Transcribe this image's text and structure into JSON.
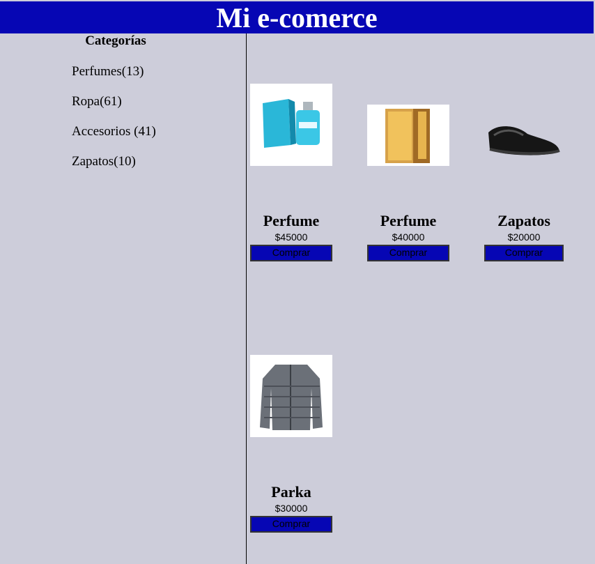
{
  "header": {
    "title": "Mi e-comerce"
  },
  "sidebar": {
    "title": "Categorías",
    "items": [
      {
        "label": "Perfumes(13)"
      },
      {
        "label": "Ropa(61)"
      },
      {
        "label": "Accesorios (41)"
      },
      {
        "label": "Zapatos(10)"
      }
    ]
  },
  "products": [
    {
      "name": "Perfume",
      "price": "$45000",
      "buy_label": "Comprar",
      "image": "blue-perfume-bottle"
    },
    {
      "name": "Perfume",
      "price": "$40000",
      "buy_label": "Comprar",
      "image": "gold-perfume-box"
    },
    {
      "name": "Zapatos",
      "price": "$20000",
      "buy_label": "Comprar",
      "image": "black-shoe"
    },
    {
      "name": "Parka",
      "price": "$30000",
      "buy_label": "Comprar",
      "image": "grey-parka"
    }
  ],
  "colors": {
    "header_bg": "#0606b4",
    "page_bg": "#cdcdda",
    "button_bg": "#0606b4"
  }
}
